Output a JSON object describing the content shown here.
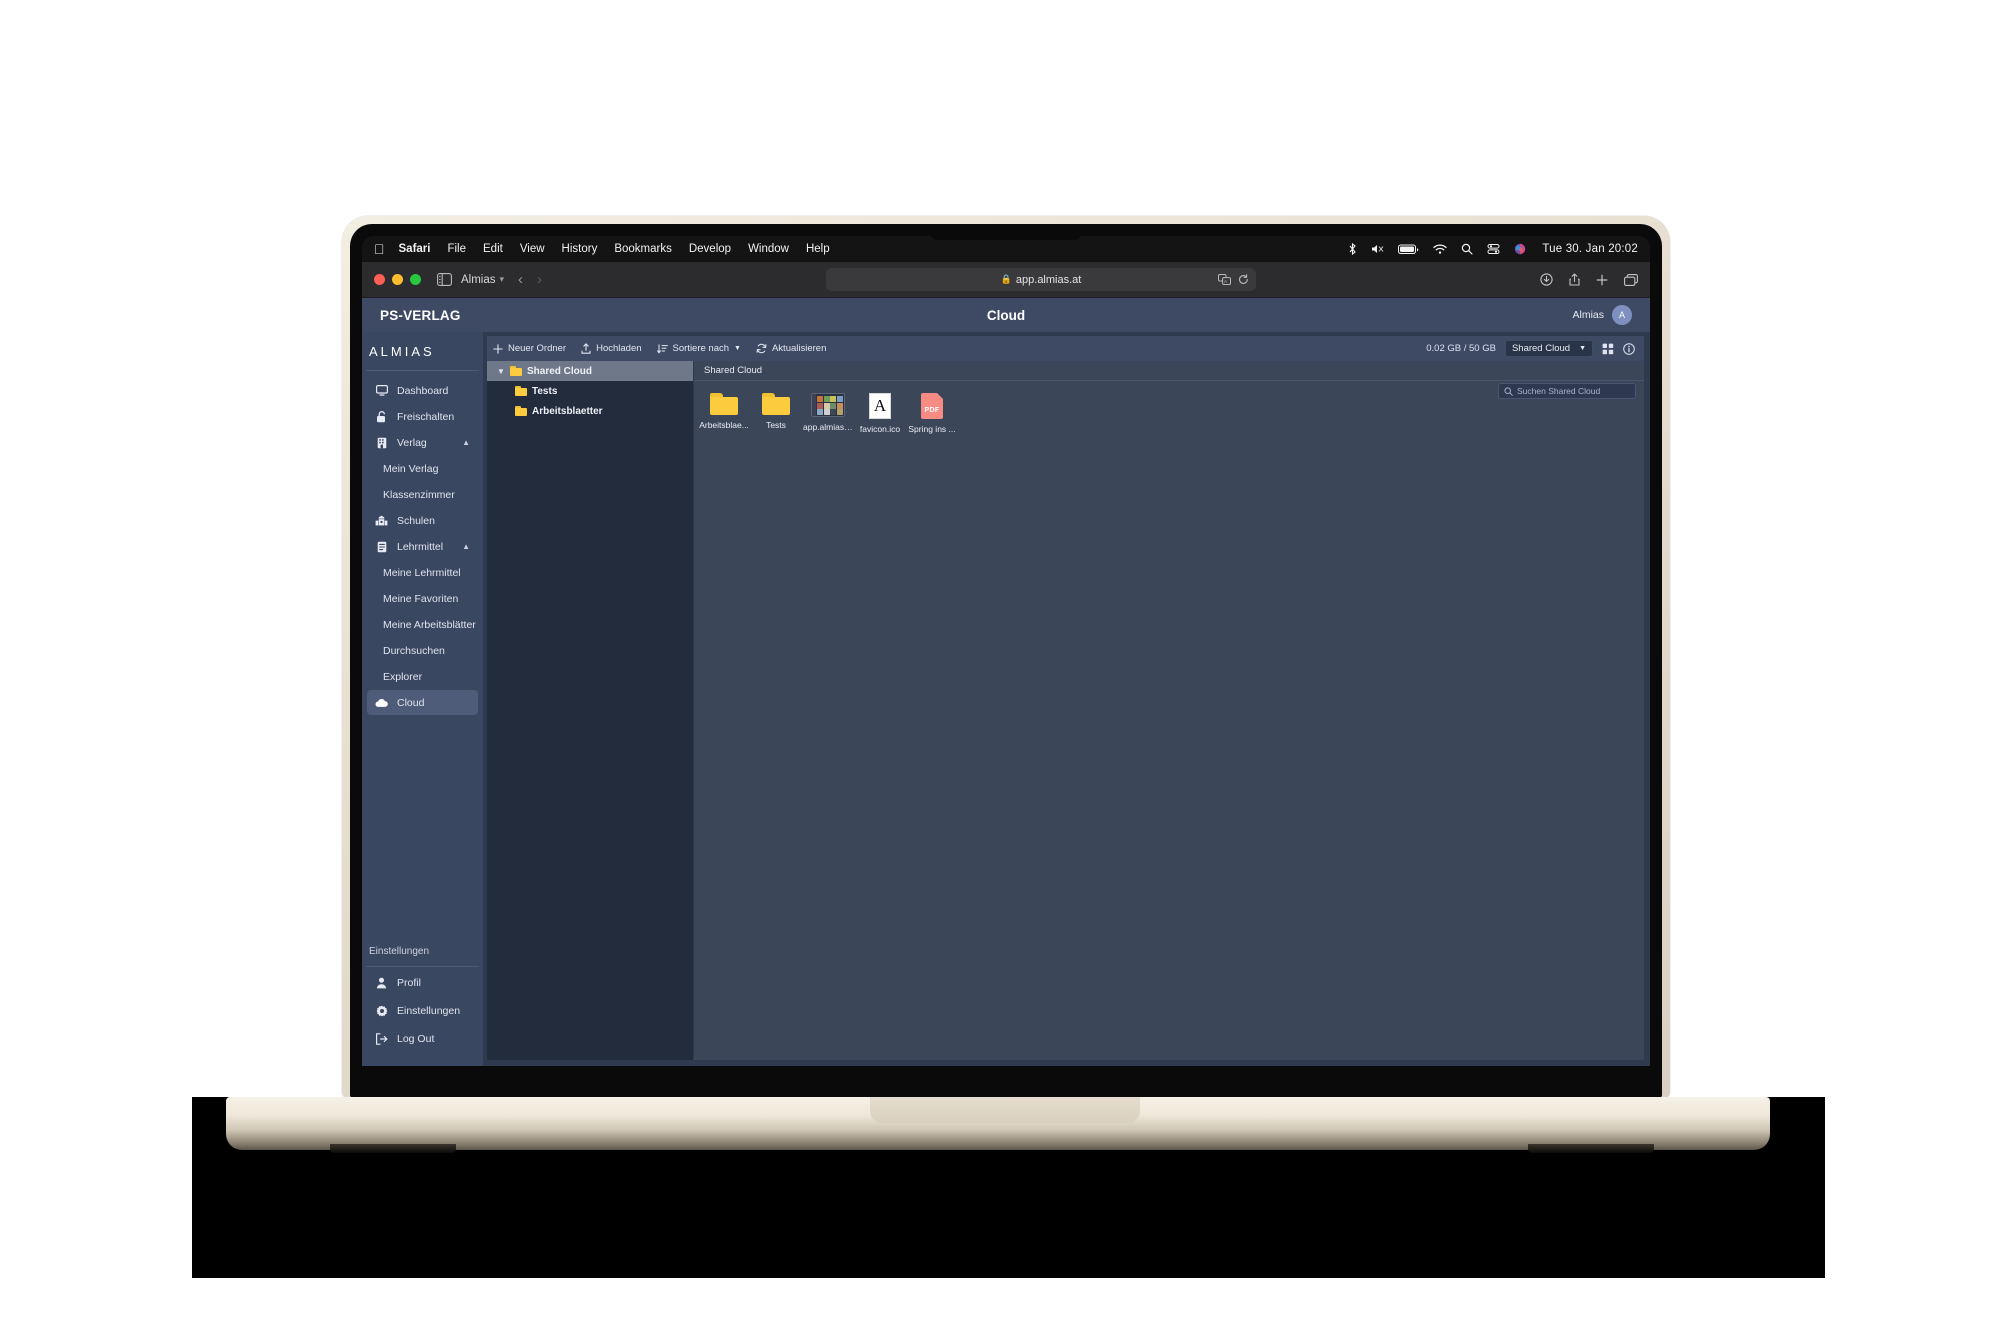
{
  "menubar": {
    "apple_icon": "apple-logo-icon",
    "items": [
      {
        "label": "Safari",
        "bold": true
      },
      {
        "label": "File",
        "bold": false
      },
      {
        "label": "Edit",
        "bold": false
      },
      {
        "label": "View",
        "bold": false
      },
      {
        "label": "History",
        "bold": false
      },
      {
        "label": "Bookmarks",
        "bold": false
      },
      {
        "label": "Develop",
        "bold": false
      },
      {
        "label": "Window",
        "bold": false
      },
      {
        "label": "Help",
        "bold": false
      }
    ],
    "status_icons": [
      "bluetooth-icon",
      "volume-muted-icon",
      "battery-icon",
      "wifi-icon",
      "search-icon",
      "control-center-icon",
      "siri-icon"
    ],
    "clock": "Tue 30. Jan  20:02"
  },
  "safari": {
    "tab_name": "Almias",
    "url": "app.almias.at",
    "lock_icon": "lock-icon",
    "back_icon": "chevron-left-icon",
    "forward_icon": "chevron-right-icon",
    "sidebar_icon": "sidebar-toggle-icon",
    "translate_icon": "translate-icon",
    "reload_icon": "reload-icon",
    "downloads_icon": "downloads-icon",
    "share_icon": "share-icon",
    "newtab_icon": "plus-icon",
    "tabs_icon": "tab-overview-icon"
  },
  "app": {
    "brand": "PS-VERLAG",
    "title": "Cloud",
    "user_name": "Almias",
    "avatar_initial": "A"
  },
  "sidebar": {
    "logo": "ALMIAS",
    "items": [
      {
        "label": "Dashboard",
        "icon": "monitor-icon",
        "type": "item"
      },
      {
        "label": "Freischalten",
        "icon": "unlock-icon",
        "type": "item"
      },
      {
        "label": "Verlag",
        "icon": "building-icon",
        "type": "item",
        "chevron": "chevron-up-icon"
      },
      {
        "label": "Mein Verlag",
        "type": "sub"
      },
      {
        "label": "Klassenzimmer",
        "type": "sub"
      },
      {
        "label": "Schulen",
        "icon": "school-icon",
        "type": "item"
      },
      {
        "label": "Lehrmittel",
        "icon": "book-icon",
        "type": "item",
        "chevron": "chevron-up-icon"
      },
      {
        "label": "Meine Lehrmittel",
        "type": "sub"
      },
      {
        "label": "Meine Favoriten",
        "type": "sub"
      },
      {
        "label": "Meine Arbeitsblätter",
        "type": "sub"
      },
      {
        "label": "Durchsuchen",
        "type": "sub"
      },
      {
        "label": "Explorer",
        "type": "sub"
      },
      {
        "label": "Cloud",
        "icon": "cloud-icon",
        "type": "item",
        "active": true
      }
    ],
    "section_title": "Einstellungen",
    "bottom_items": [
      {
        "label": "Profil",
        "icon": "person-icon"
      },
      {
        "label": "Einstellungen",
        "icon": "gear-icon"
      },
      {
        "label": "Log Out",
        "icon": "logout-icon"
      }
    ]
  },
  "cloud": {
    "toolbar": {
      "new_folder": "Neuer Ordner",
      "upload": "Hochladen",
      "sort_by": "Sortiere nach",
      "refresh": "Aktualisieren",
      "quota": "0.02 GB / 50 GB",
      "location": "Shared Cloud",
      "grid_view_icon": "grid-view-icon",
      "info_icon": "info-icon"
    },
    "tree": [
      {
        "label": "Shared Cloud",
        "level": 0,
        "expanded": true,
        "selected": true
      },
      {
        "label": "Tests",
        "level": 1,
        "expanded": false,
        "selected": false
      },
      {
        "label": "Arbeitsblaetter",
        "level": 1,
        "expanded": false,
        "selected": false
      }
    ],
    "breadcrumb": "Shared Cloud",
    "search_placeholder": "Suchen Shared Cloud",
    "files": [
      {
        "label": "Arbeitsblae...",
        "kind": "folder"
      },
      {
        "label": "Tests",
        "kind": "folder"
      },
      {
        "label": "app.almias....",
        "kind": "screenshot"
      },
      {
        "label": "favicon.ico",
        "kind": "ico",
        "glyph": "A"
      },
      {
        "label": "Spring ins ...",
        "kind": "pdf",
        "glyph": "PDF"
      }
    ]
  },
  "colors": {
    "app_header": "#3e4a63",
    "sidebar": "#3a4760",
    "panel_dark": "#222c3d",
    "file_pane": "#3c4659",
    "accent_folder": "#fccc3e",
    "pdf": "#f78a82",
    "active_item": "#4e5c79"
  }
}
